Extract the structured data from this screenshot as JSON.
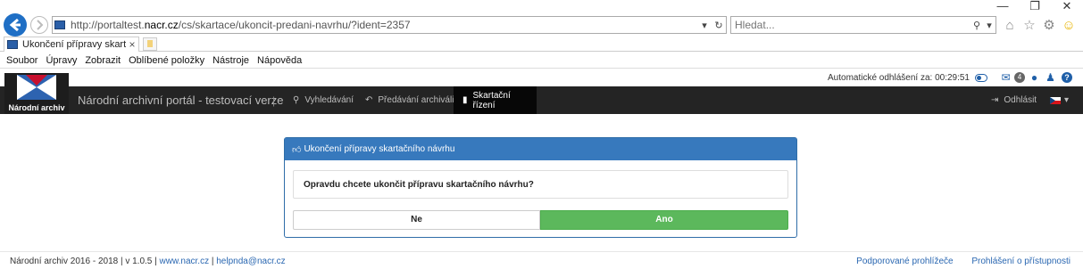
{
  "browser": {
    "window_controls": {
      "minimize": "—",
      "restore": "❐",
      "close": "✕"
    },
    "url_prefix": "http://portaltest.",
    "url_domain": "nacr.cz",
    "url_path": "/cs/skartace/ukoncit-predani-navrhu/?ident=2357",
    "search_placeholder": "Hledat...",
    "tab_title": "Ukončení přípravy skartační...",
    "menu": [
      "Soubor",
      "Úpravy",
      "Zobrazit",
      "Oblíbené položky",
      "Nástroje",
      "Nápověda"
    ],
    "icons": [
      "home-icon",
      "favorites-star-icon",
      "settings-gear-icon",
      "feedback-smiley-icon"
    ]
  },
  "topinfo": {
    "logout_timer": "Automatické odhlášení za: 00:29:51",
    "messages_count": "4"
  },
  "navbar": {
    "logo_text": "Národní archiv",
    "site_title": "Národní archivní portál - testovací verze",
    "separator": "|",
    "items": [
      {
        "label": "Vyhledávání",
        "icon": "search-icon"
      },
      {
        "label": "Předávání archiválií",
        "icon": "reply-icon"
      },
      {
        "label": "Skartační řízení",
        "icon": "trash-icon",
        "active": true
      }
    ],
    "logout_label": "Odhlásit",
    "language": "cs"
  },
  "dialog": {
    "title": "Ukončení přípravy skartačního návrhu",
    "question": "Opravdu chcete ukončit přípravu skartačního návrhu?",
    "no_label": "Ne",
    "yes_label": "Ano"
  },
  "footer": {
    "copyright": "Národní archiv 2016 - 2018 | v 1.0.5 | ",
    "website": "www.nacr.cz",
    "sep": " | ",
    "email": "helpnda@nacr.cz",
    "links": [
      "Podporované prohlížeče",
      "Prohlášení o přístupnosti"
    ]
  },
  "colors": {
    "navbar_bg": "#242424",
    "dialog_header": "#3779bd",
    "confirm_button": "#5cb85c",
    "link": "#2a67b1"
  }
}
